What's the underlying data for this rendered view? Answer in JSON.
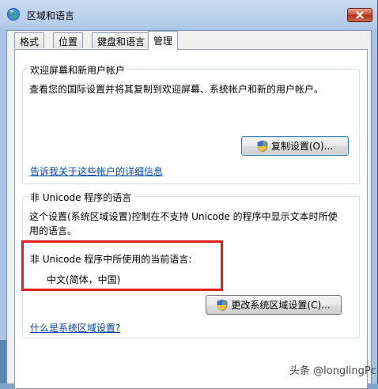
{
  "window": {
    "title": "区域和语言"
  },
  "tabs": [
    {
      "label": "格式",
      "active": false
    },
    {
      "label": "位置",
      "active": false
    },
    {
      "label": "键盘和语言",
      "active": false
    },
    {
      "label": "管理",
      "active": true
    }
  ],
  "welcome_group": {
    "title": "欢迎屏幕和新用户帐户",
    "description": "查看您的国际设置并将其复制到欢迎屏幕、系统帐户和新的用户帐户。",
    "copy_button": "复制设置(O)...",
    "link": "告诉我关于这些帐户的详细信息"
  },
  "unicode_group": {
    "title": "非 Unicode 程序的语言",
    "description_line1": "这个设置(系统区域设置)控制在不支持 Unicode 的程序中显示文本时所使",
    "description_line2": "用的语言。",
    "current_label": "非 Unicode 程序中所使用的当前语言:",
    "current_value": "中文(简体，中国)",
    "change_button": "更改系统区域设置(C)...",
    "link": "什么是系统区域设置?"
  },
  "watermark": "头条 @longlingPc",
  "colors": {
    "highlight": "#e0201f",
    "link": "#0645ad",
    "close": "#c8452c"
  }
}
